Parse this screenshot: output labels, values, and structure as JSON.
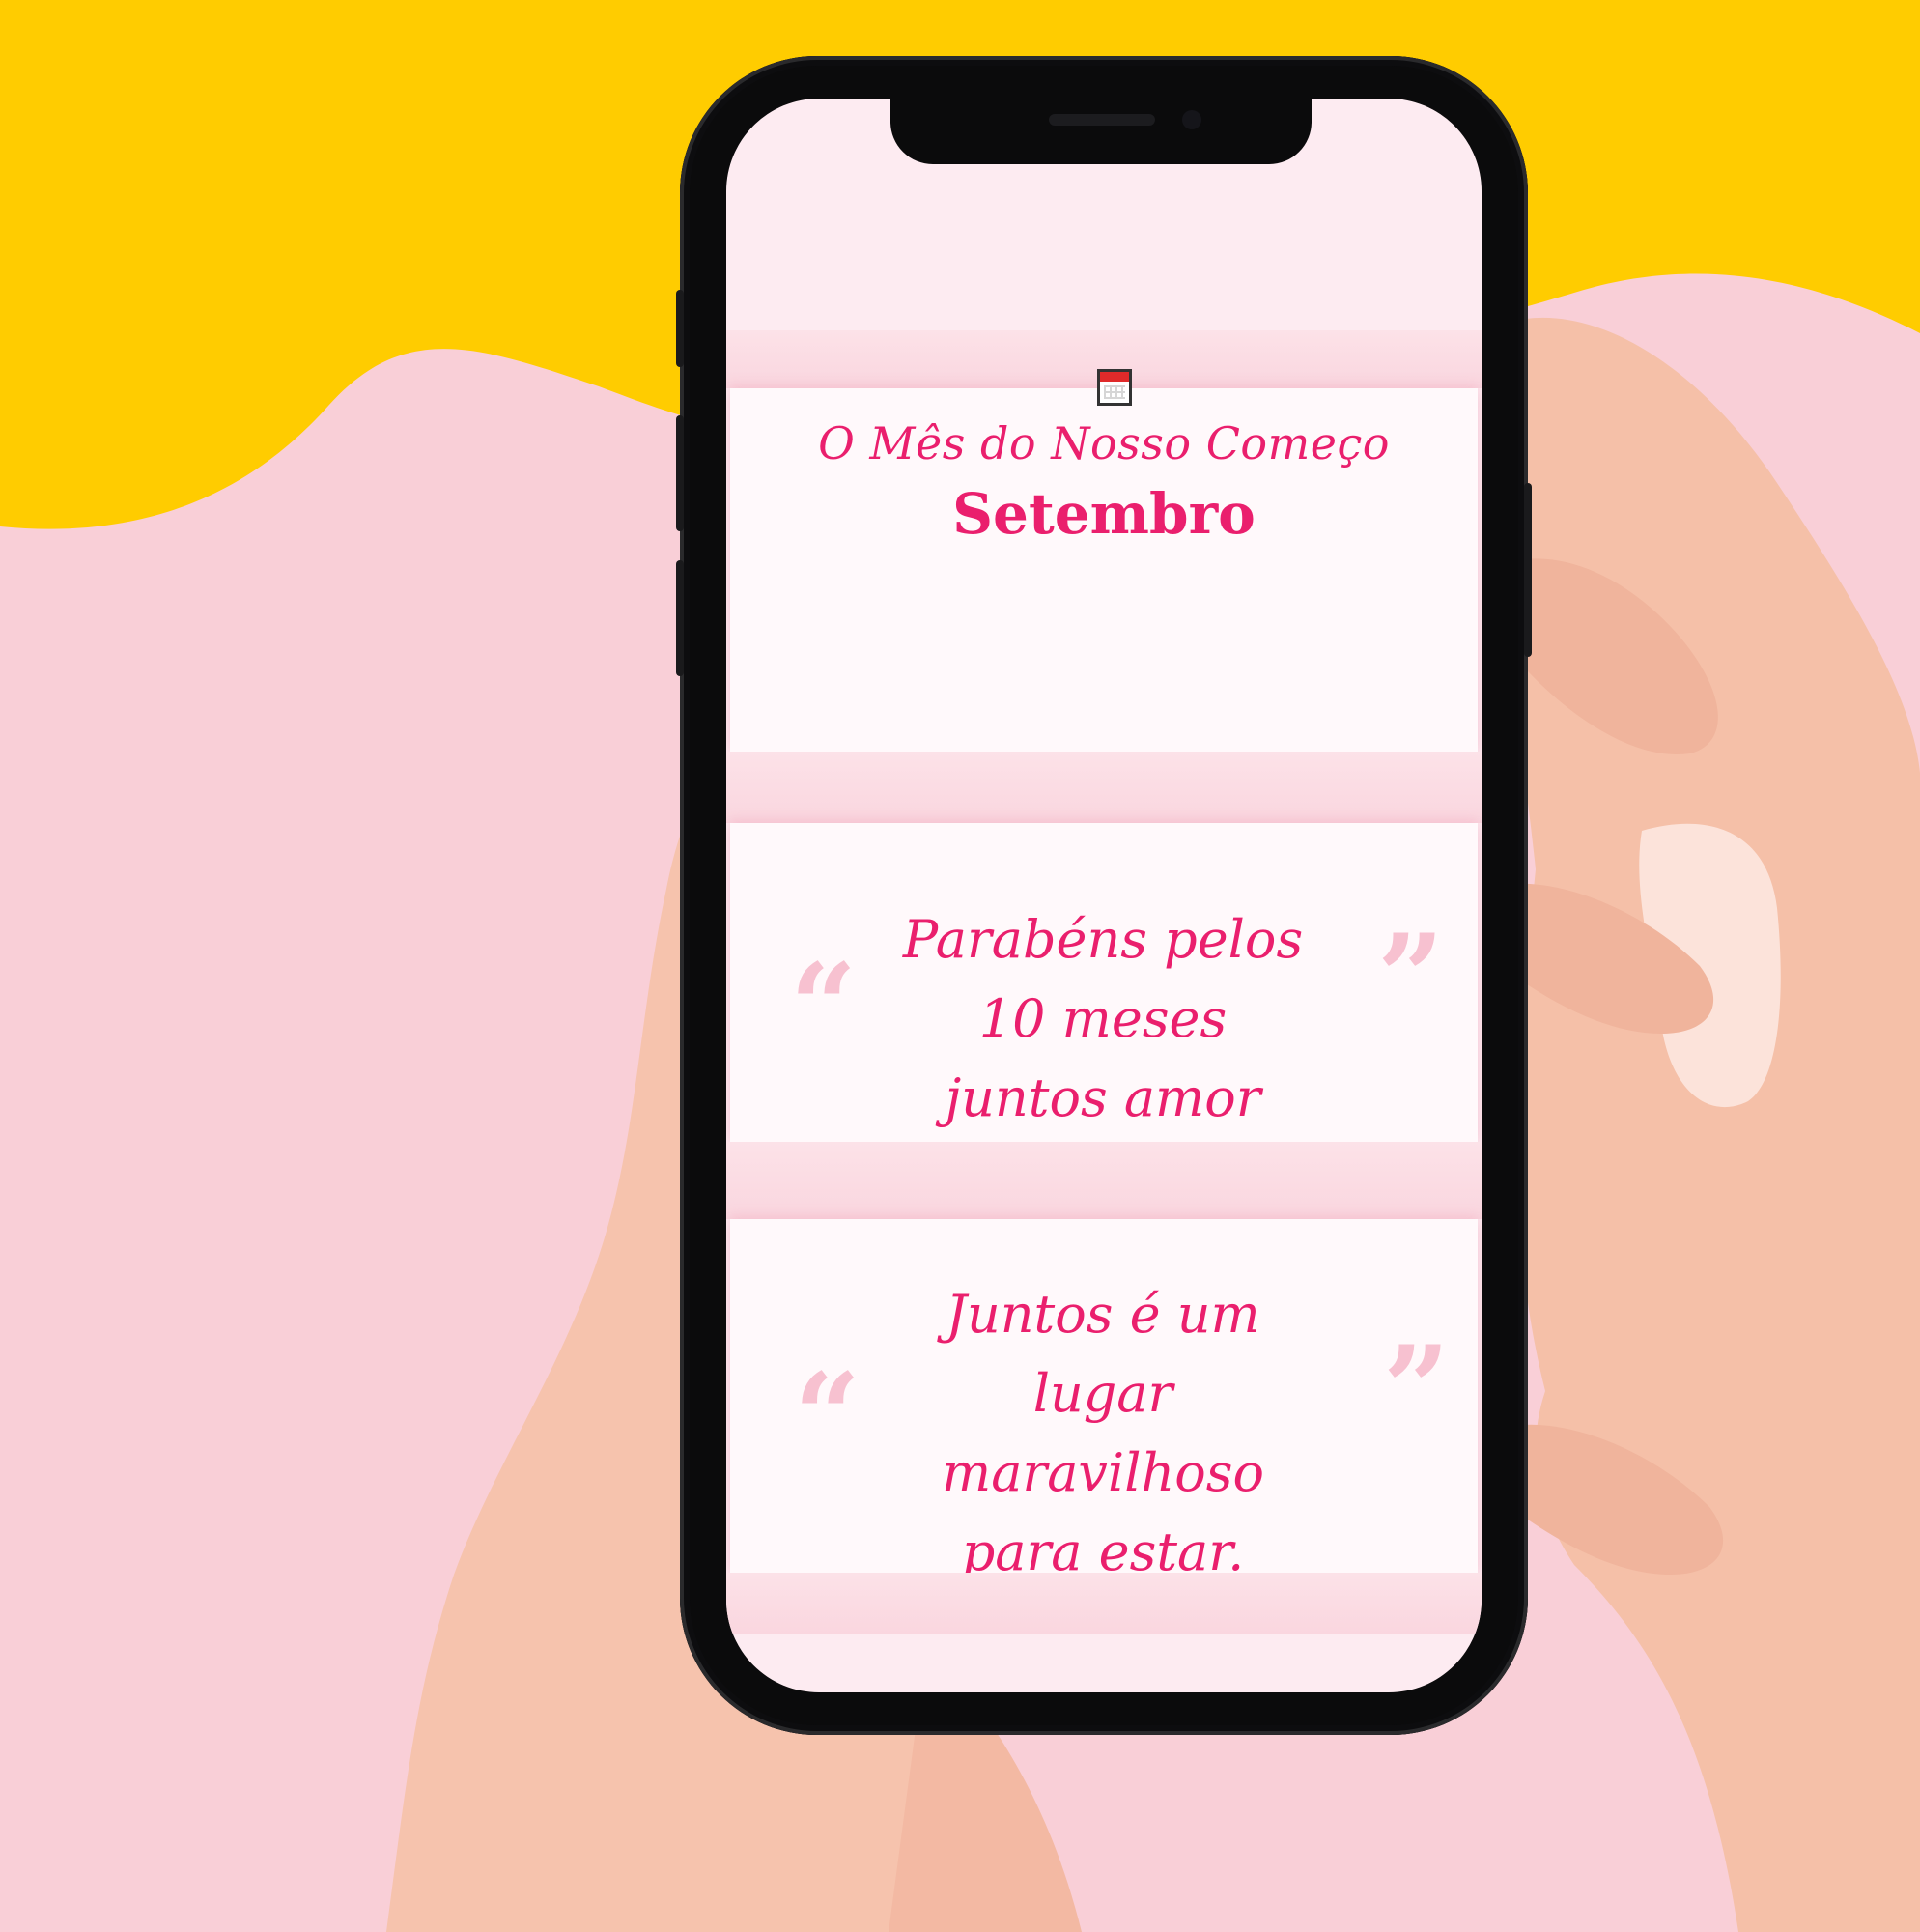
{
  "colors": {
    "background_pink": "#f9cfd7",
    "background_yellow": "#ffcc00",
    "accent": "#ea1f6d",
    "quote_mark": "#f7c1d0",
    "screen_bg": "#fdebf1"
  },
  "header_card": {
    "icon": "calendar-icon",
    "title": "O Mês do Nosso Começo",
    "month": "Setembro"
  },
  "quotes": [
    {
      "open_mark": "“",
      "text": "Parabéns pelos 10 meses juntos amor",
      "close_mark": "”"
    },
    {
      "open_mark": "“",
      "text": "Juntos é um lugar maravilhoso para estar.",
      "close_mark": "”"
    }
  ]
}
